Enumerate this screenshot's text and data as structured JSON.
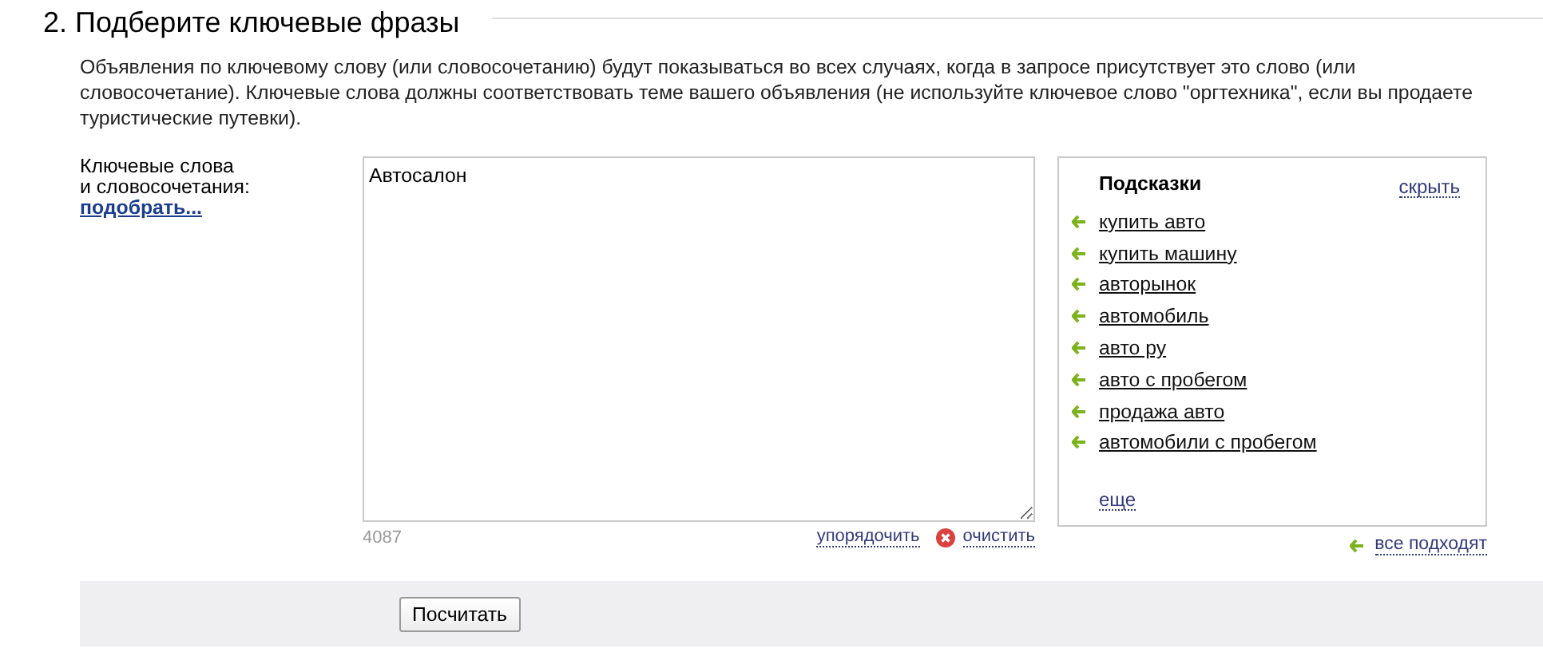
{
  "heading": "2. Подберите ключевые фразы",
  "description": "Объявления по ключевому слову (или словосочетанию) будут показываться во всех случаях, когда в запросе присутствует это слово (или словосочетание). Ключевые слова должны соответствовать теме вашего объявления (не используйте ключевое слово \"оргтехника\", если вы продаете туристические путевки).",
  "field_label": [
    "Ключевые слова",
    "и словосочетания:"
  ],
  "pick_link": "подобрать...",
  "keywords": {
    "value": "Автосалон",
    "counter": "4087"
  },
  "actions": {
    "sort": "упорядочить",
    "clear": "очистить"
  },
  "hints": {
    "title": "Подсказки",
    "hide": "скрыть",
    "more": "еще",
    "accept_all": "все подходят",
    "items": [
      "купить авто",
      "купить машину",
      "авторынок",
      "автомобиль",
      "авто ру",
      "авто с пробегом",
      "продажа авто",
      "автомобили с пробегом"
    ]
  },
  "submit": "Посчитать"
}
